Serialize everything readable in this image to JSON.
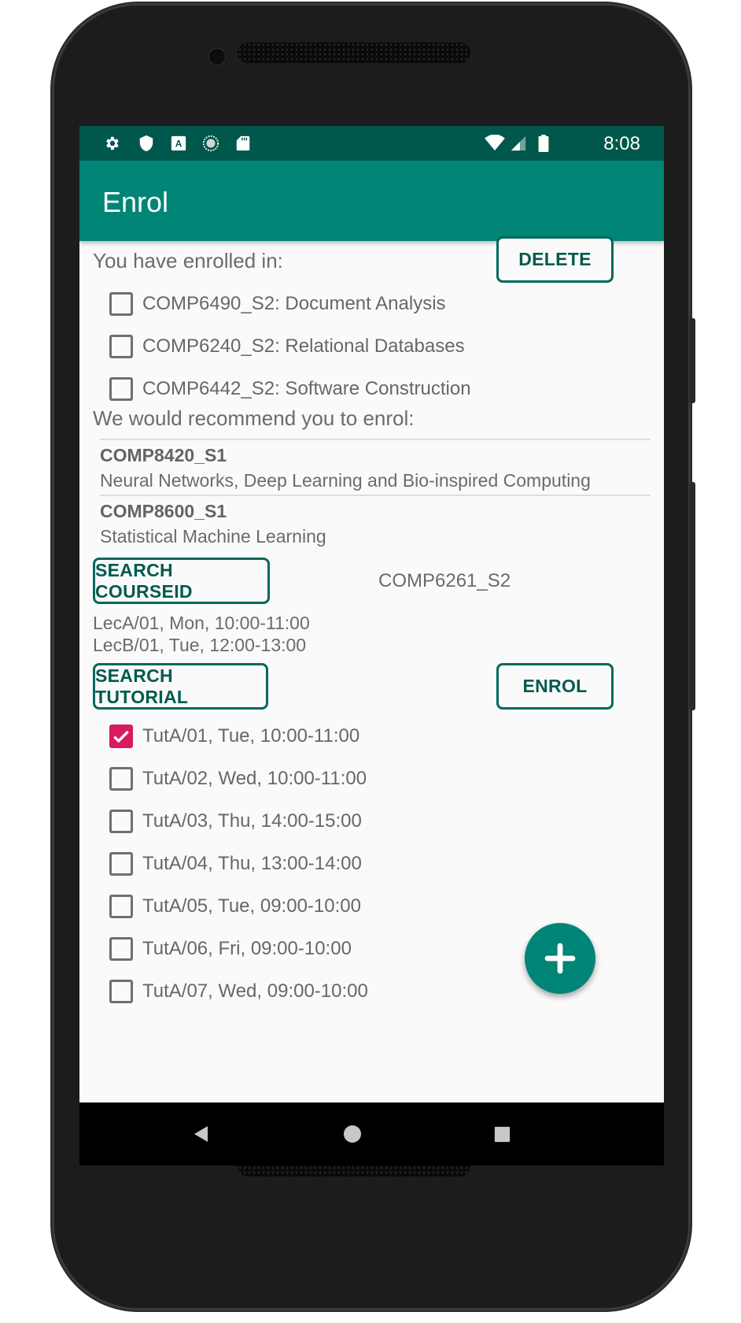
{
  "status_bar": {
    "time": "8:08",
    "left_icons": [
      "gear-icon",
      "shield-icon",
      "a-box-icon",
      "sync-circle-icon",
      "sd-card-icon"
    ],
    "right_icons": [
      "wifi-icon",
      "signal-icon",
      "battery-icon"
    ]
  },
  "app_bar": {
    "title": "Enrol"
  },
  "enrolled": {
    "heading": "You have enrolled in:",
    "delete_label": "DELETE",
    "items": [
      {
        "label": "COMP6490_S2: Document Analysis",
        "checked": false
      },
      {
        "label": "COMP6240_S2: Relational Databases",
        "checked": false
      },
      {
        "label": "COMP6442_S2: Software Construction",
        "checked": false
      }
    ]
  },
  "recommend": {
    "heading": "We would recommend you to enrol:",
    "items": [
      {
        "code": "COMP8420_S1",
        "name": "Neural Networks, Deep Learning and Bio-inspired Computing"
      },
      {
        "code": "COMP8600_S1",
        "name": "Statistical Machine Learning"
      }
    ]
  },
  "search": {
    "course_button": "SEARCH COURSEID",
    "course_value": "COMP6261_S2",
    "lectures": [
      "LecA/01, Mon, 10:00-11:00",
      "LecB/01, Tue, 12:00-13:00"
    ],
    "tutorial_button": "SEARCH TUTORIAL",
    "enrol_button": "ENROL"
  },
  "tutorials": [
    {
      "label": "TutA/01, Tue, 10:00-11:00",
      "checked": true
    },
    {
      "label": "TutA/02, Wed, 10:00-11:00",
      "checked": false
    },
    {
      "label": "TutA/03, Thu, 14:00-15:00",
      "checked": false
    },
    {
      "label": "TutA/04, Thu, 13:00-14:00",
      "checked": false
    },
    {
      "label": "TutA/05, Tue, 09:00-10:00",
      "checked": false
    },
    {
      "label": "TutA/06, Fri, 09:00-10:00",
      "checked": false
    },
    {
      "label": "TutA/07, Wed, 09:00-10:00",
      "checked": false
    }
  ],
  "fab": {
    "icon": "plus-icon"
  },
  "nav_bar": {
    "icons": [
      "back-icon",
      "home-icon",
      "recents-icon"
    ]
  },
  "colors": {
    "primary": "#008577",
    "primary_dark": "#00574b",
    "accent": "#d81b60"
  }
}
